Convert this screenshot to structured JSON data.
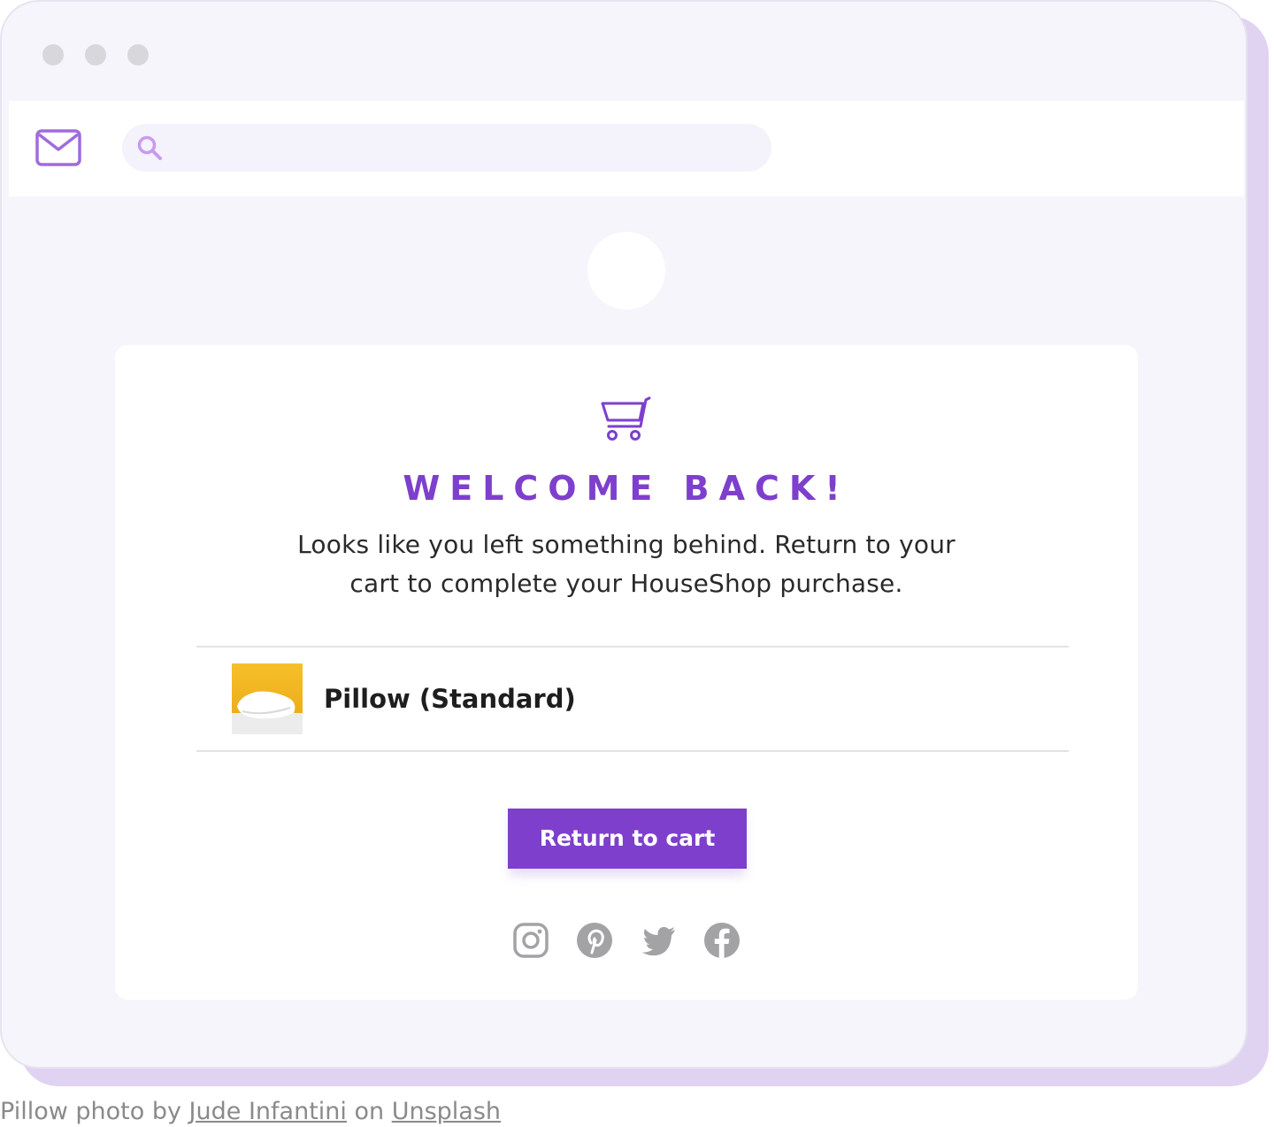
{
  "window": {
    "controls": [
      "window-dot",
      "window-dot",
      "window-dot"
    ]
  },
  "toolbar": {
    "mail_icon": "mail-icon",
    "search": {
      "icon": "search-icon",
      "placeholder": "",
      "value": ""
    }
  },
  "email": {
    "cart_icon": "shopping-cart-icon",
    "headline": "WELCOME BACK!",
    "message": "Looks like you left something behind. Return to your cart to complete your HouseShop purchase.",
    "product": {
      "name": "Pillow (Standard)",
      "image": "pillow-photo"
    },
    "cta_label": "Return to cart",
    "social": [
      "instagram-icon",
      "pinterest-icon",
      "twitter-icon",
      "facebook-icon"
    ]
  },
  "caption": {
    "prefix": "Pillow photo by ",
    "author": "Jude Infantini",
    "middle": " on ",
    "source": "Unsplash"
  },
  "colors": {
    "accent": "#7e3fcd",
    "window_bg": "#f6f5fb",
    "shadow": "#e0d3f2",
    "icon_gray": "#a3a3a6",
    "search_icon": "#c79bf0"
  }
}
